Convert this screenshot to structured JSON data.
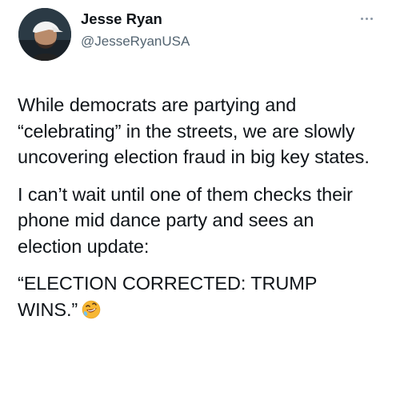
{
  "author": {
    "display_name": "Jesse Ryan",
    "handle": "@JesseRyanUSA"
  },
  "tweet": {
    "paragraph_1": "While democrats are partying and “celebrating” in the streets, we are slowly uncovering election fraud in big key states.",
    "paragraph_2": "I can’t wait until one of them checks their phone mid dance party and sees an election update:",
    "paragraph_3": "“ELECTION CORRECTED: TRUMP WINS.”",
    "emoji_icon": "rolling-on-the-floor-laughing-emoji"
  },
  "colors": {
    "text": "#0f1419",
    "secondary_text": "#536471",
    "emoji": "#f7b733"
  }
}
